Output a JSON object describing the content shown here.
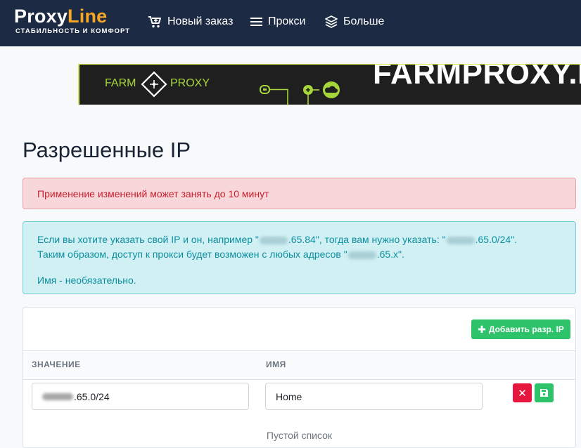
{
  "brand": {
    "name_a": "Proxy",
    "name_b": "Line",
    "tagline": "СТАБИЛЬНОСТЬ И КОМФОРТ",
    "accent_color": "#f5a623"
  },
  "nav": {
    "items": [
      {
        "label": "Новый заказ",
        "icon": "cart-plus-icon"
      },
      {
        "label": "Прокси",
        "icon": "list-icon"
      },
      {
        "label": "Больше",
        "icon": "layers-icon"
      }
    ]
  },
  "banner": {
    "farm": "FARM",
    "proxy": "PROXY",
    "big_text": "FARMPROXY.R"
  },
  "page": {
    "title": "Разрешенные IP"
  },
  "alerts": {
    "danger": "Применение изменений может занять до 10 минут",
    "info": {
      "line1_a": "Если вы хотите указать свой IP и он, например \"",
      "line1_b": ".65.84\", тогда вам нужно указать: \"",
      "line1_c": ".65.0/24\".",
      "line2_a": "Таким образом, доступ к прокси будет возможен с любых адресов \"",
      "line2_b": ".65.x\".",
      "line3": "Имя - необязательно."
    }
  },
  "table": {
    "add_button": "Добавить разр. IP",
    "headers": {
      "value": "ЗНАЧЕНИЕ",
      "name": "ИМЯ"
    },
    "rows": [
      {
        "value": ".65.0/24",
        "name": "Home"
      }
    ],
    "empty_text": "Пустой список"
  }
}
